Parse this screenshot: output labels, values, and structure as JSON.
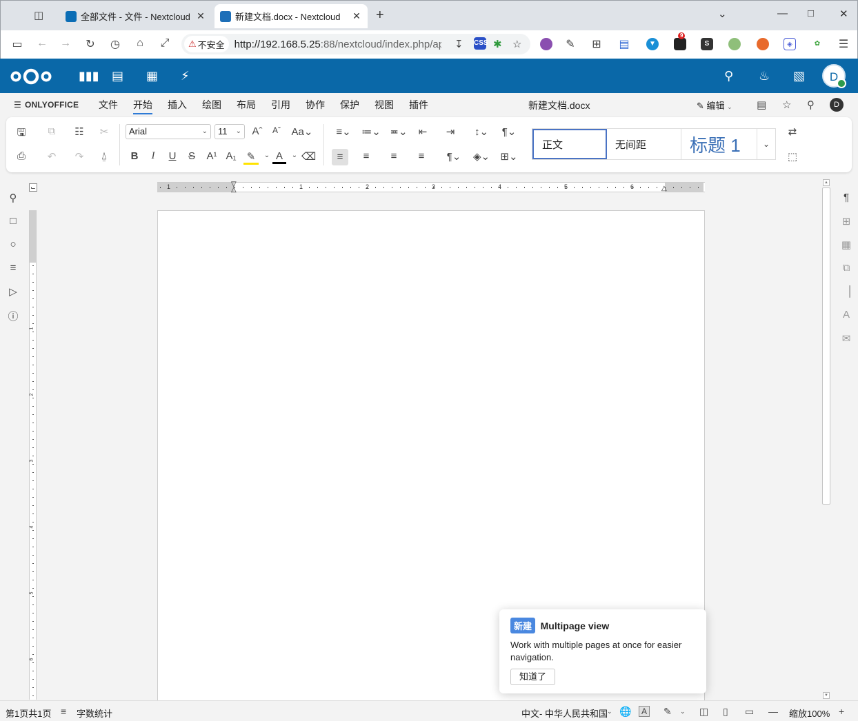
{
  "browser": {
    "tabs": [
      {
        "title": "全部文件 - 文件 - Nextcloud",
        "active": false
      },
      {
        "title": "新建文档.docx - Nextcloud",
        "active": true
      }
    ],
    "security_label": "不安全",
    "url_host": "http://192.168.5.25",
    "url_rest": ":88/nextcloud/index.php/ap",
    "ext_css_label": "CSS",
    "ext_badge": "9",
    "ext_s_label": "S"
  },
  "nextcloud": {
    "avatar_letter": "D"
  },
  "onlyoffice": {
    "logo": "ONLYOFFICE",
    "menu": [
      "文件",
      "开始",
      "插入",
      "绘图",
      "布局",
      "引用",
      "协作",
      "保护",
      "视图",
      "插件"
    ],
    "active_menu": "开始",
    "doc_title": "新建文档.docx",
    "edit_label": "编辑",
    "user_initial": "D"
  },
  "toolbar": {
    "font_name": "Arial",
    "font_size": "11",
    "styles": [
      "正文",
      "无间距",
      "标题 1"
    ]
  },
  "ruler": {
    "h_numbers": [
      "1",
      "1",
      "2",
      "3",
      "4",
      "5",
      "6"
    ],
    "v_numbers": [
      "1",
      "2",
      "3",
      "4",
      "5",
      "6"
    ]
  },
  "tip": {
    "badge": "新建",
    "title": "Multipage view",
    "body": "Work with multiple pages at once for easier navigation.",
    "button": "知道了"
  },
  "status": {
    "page_info": "第1页共1页",
    "word_count": "字数统计",
    "language": "中文- 中华人民共和国",
    "zoom": "缩放100%"
  },
  "colors": {
    "nc_header": "#0a68a8",
    "accent": "#2e7bd6",
    "heading_style": "#3a6fb6"
  }
}
